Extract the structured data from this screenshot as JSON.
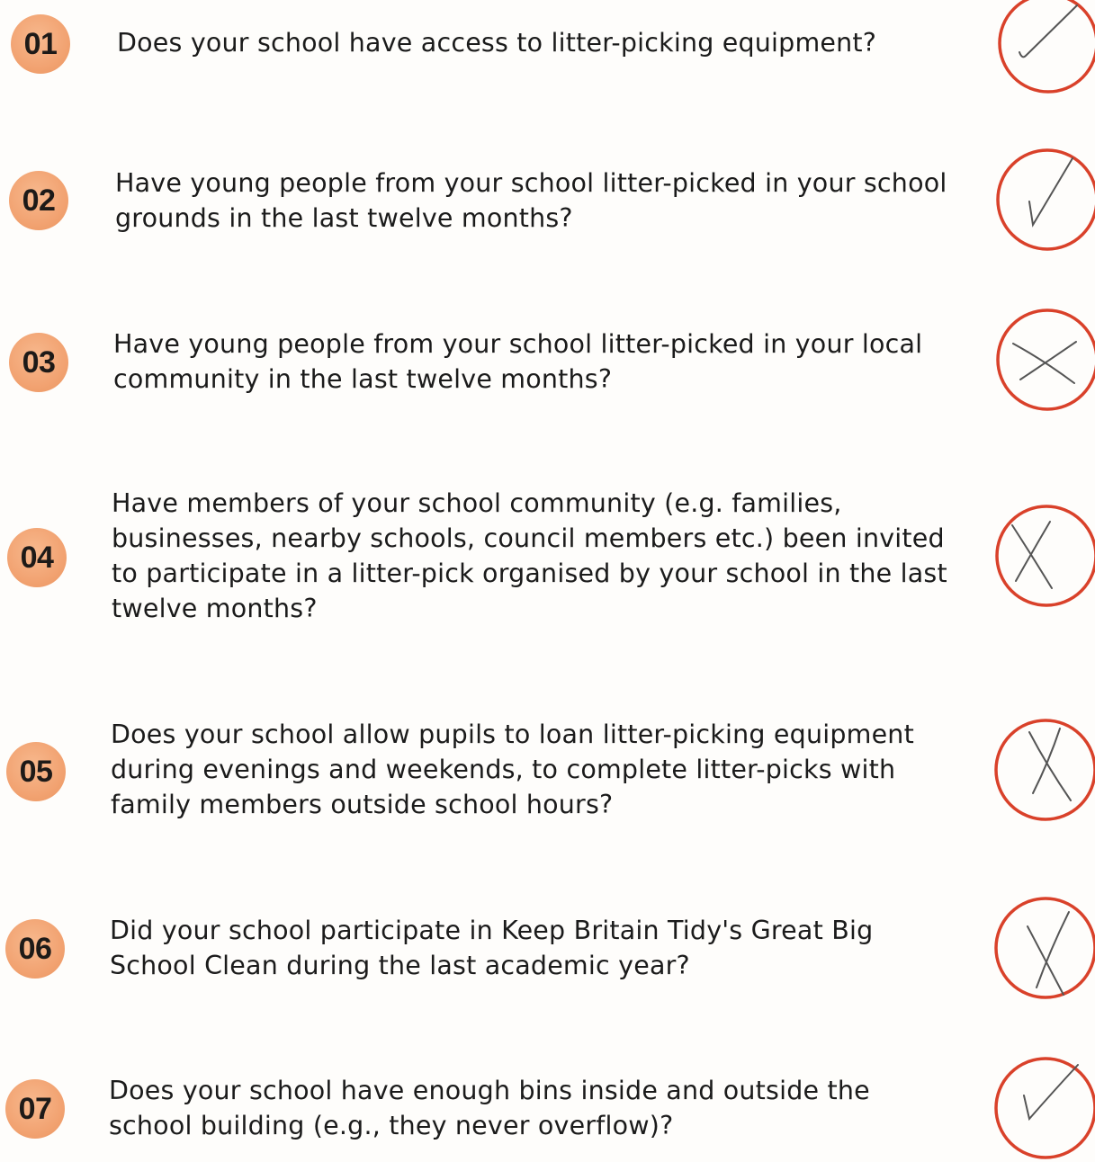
{
  "questions": [
    {
      "number": "01",
      "text": "Does your school have access to litter-picking equipment?",
      "answer": "tick"
    },
    {
      "number": "02",
      "text": "Have young people from your school litter-picked in your school grounds in the last twelve months?",
      "answer": "tick"
    },
    {
      "number": "03",
      "text": "Have young people from your school litter-picked in your local community in the last twelve months?",
      "answer": "cross"
    },
    {
      "number": "04",
      "text": "Have members of your school community (e.g. families, businesses, nearby schools, council members etc.) been invited to participate in a litter-pick organised by your school in the last twelve months?",
      "answer": "cross"
    },
    {
      "number": "05",
      "text": "Does your school allow pupils to loan litter-picking equipment during evenings and weekends, to complete litter-picks with family members outside school hours?",
      "answer": "cross"
    },
    {
      "number": "06",
      "text": "Did your school participate in Keep Britain Tidy's Great Big School Clean during the last academic year?",
      "answer": "cross"
    },
    {
      "number": "07",
      "text": "Does your school have enough bins inside and outside the school building (e.g., they never overflow)?",
      "answer": "tick"
    }
  ],
  "colors": {
    "badge": "#f2a372",
    "circle": "#d9412a",
    "pen": "#555555"
  },
  "icons": {
    "tick": "handwritten-tick-icon",
    "cross": "handwritten-cross-icon"
  }
}
